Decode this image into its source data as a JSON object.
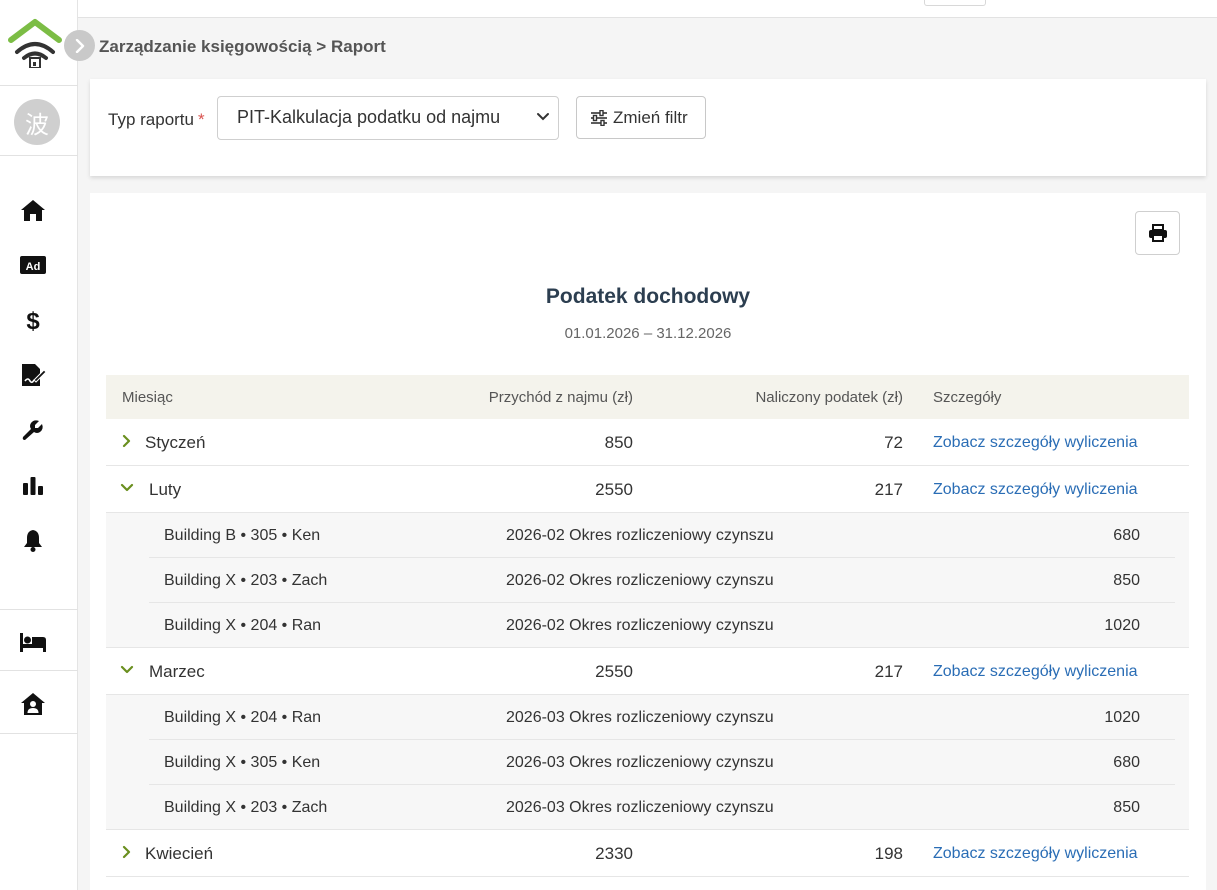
{
  "sidebar": {
    "avatar_char": "波",
    "nav": [
      "home-icon",
      "ad-icon",
      "dollar-icon",
      "contract-icon",
      "wrench-icon",
      "chart-icon",
      "bell-icon",
      "bed-icon",
      "house-user-icon"
    ]
  },
  "breadcrumb": "Zarządzanie księgowością > Raport",
  "filter": {
    "label": "Typ raportu",
    "required_mark": "*",
    "selected": "PIT-Kalkulacja podatku od najmu",
    "button_label": "Zmień filtr"
  },
  "report": {
    "title": "Podatek dochodowy",
    "date_range": "01.01.2026 – 31.12.2026",
    "columns": {
      "month": "Miesiąc",
      "income": "Przychód z najmu (zł)",
      "tax": "Naliczony podatek (zł)",
      "details": "Szczegóły"
    },
    "rows": [
      {
        "month": "Styczeń",
        "income": "850",
        "tax": "72",
        "link": "Zobacz szczegóły wyliczenia",
        "expanded": false,
        "items": []
      },
      {
        "month": "Luty",
        "income": "2550",
        "tax": "217",
        "link": "Zobacz szczegóły wyliczenia",
        "expanded": true,
        "items": [
          {
            "unit": "Building B • 305 • Ken",
            "period": "2026-02 Okres rozliczeniowy czynszu",
            "amount": "680"
          },
          {
            "unit": "Building X • 203 • Zach",
            "period": "2026-02 Okres rozliczeniowy czynszu",
            "amount": "850"
          },
          {
            "unit": "Building X • 204 • Ran",
            "period": "2026-02 Okres rozliczeniowy czynszu",
            "amount": "1020"
          }
        ]
      },
      {
        "month": "Marzec",
        "income": "2550",
        "tax": "217",
        "link": "Zobacz szczegóły wyliczenia",
        "expanded": true,
        "items": [
          {
            "unit": "Building X • 204 • Ran",
            "period": "2026-03 Okres rozliczeniowy czynszu",
            "amount": "1020"
          },
          {
            "unit": "Building X • 305 • Ken",
            "period": "2026-03 Okres rozliczeniowy czynszu",
            "amount": "680"
          },
          {
            "unit": "Building X • 203 • Zach",
            "period": "2026-03 Okres rozliczeniowy czynszu",
            "amount": "850"
          }
        ]
      },
      {
        "month": "Kwiecień",
        "income": "2330",
        "tax": "198",
        "link": "Zobacz szczegóły wyliczenia",
        "expanded": false,
        "items": []
      }
    ]
  },
  "colors": {
    "accent_green": "#6a8f1f",
    "link": "#2a6db5",
    "header_bg": "#f4f3ec",
    "title": "#2c3e50"
  }
}
